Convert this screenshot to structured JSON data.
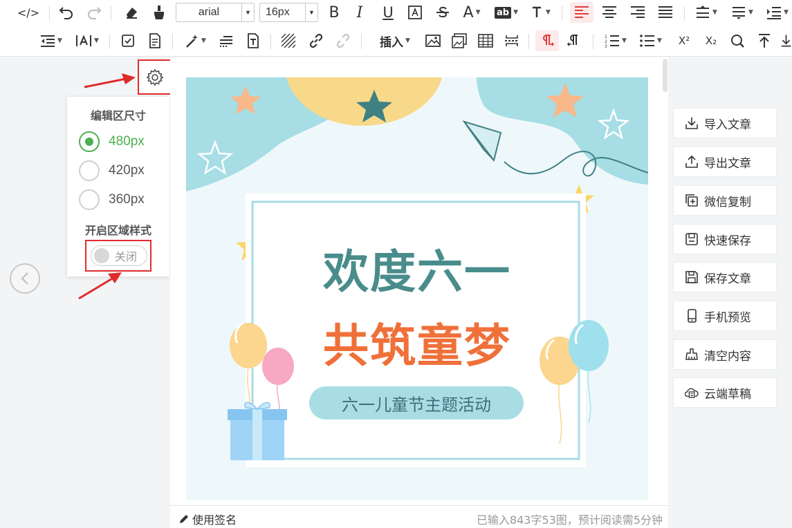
{
  "toolbar": {
    "font_family": "arial",
    "font_size": "16px",
    "insert_label": "插入",
    "glyphs": {
      "source": "</>",
      "bold": "B",
      "italic": "I",
      "underline": "U",
      "font_color": "A",
      "highlight": "ab",
      "superscript": "X²",
      "subscript": "X₂"
    }
  },
  "settings": {
    "title": "编辑区尺寸",
    "sizes": [
      {
        "label": "480px",
        "selected": true
      },
      {
        "label": "420px",
        "selected": false
      },
      {
        "label": "360px",
        "selected": false
      }
    ],
    "region_style_title": "开启区域样式",
    "region_style_toggle": "关闭"
  },
  "poster": {
    "line1": "欢度六一",
    "line2": "共筑童梦",
    "subtitle": "六一儿童节主题活动"
  },
  "statusbar": {
    "signature": "使用签名",
    "word_count": "已输入843字53图，预计阅读需5分钟"
  },
  "actions": [
    {
      "label": "导入文章",
      "icon": "import-icon"
    },
    {
      "label": "导出文章",
      "icon": "export-icon"
    },
    {
      "label": "微信复制",
      "icon": "copy-icon"
    },
    {
      "label": "快速保存",
      "icon": "save-icon"
    },
    {
      "label": "保存文章",
      "icon": "save-article-icon"
    },
    {
      "label": "手机预览",
      "icon": "phone-icon"
    },
    {
      "label": "清空内容",
      "icon": "clear-icon"
    },
    {
      "label": "云端草稿",
      "icon": "cloud-icon"
    }
  ],
  "colors": {
    "accent_green": "#4caf50",
    "annotation_red": "#e02b2b",
    "title_teal": "#4a8c8c",
    "title_orange": "#f0703a"
  }
}
